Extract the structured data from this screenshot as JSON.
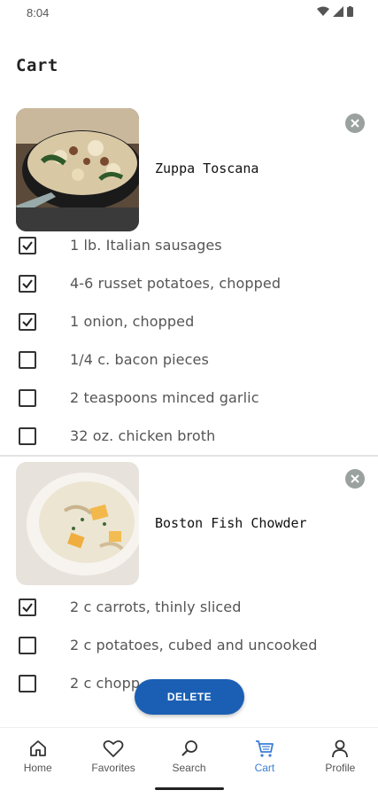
{
  "status": {
    "time": "8:04"
  },
  "page": {
    "title": "Cart"
  },
  "recipes": [
    {
      "name": "Zuppa Toscana",
      "ingredients": [
        {
          "label": "1 lb. Italian sausages",
          "checked": true
        },
        {
          "label": "4-6 russet potatoes, chopped",
          "checked": true
        },
        {
          "label": "1 onion, chopped",
          "checked": true
        },
        {
          "label": "1/4 c. bacon pieces",
          "checked": false
        },
        {
          "label": "2 teaspoons minced garlic",
          "checked": false
        },
        {
          "label": "32 oz. chicken broth",
          "checked": false
        }
      ]
    },
    {
      "name": "Boston Fish Chowder",
      "ingredients": [
        {
          "label": "2 c carrots, thinly sliced",
          "checked": true
        },
        {
          "label": "2 c potatoes, cubed and uncooked",
          "checked": false
        },
        {
          "label": "2 c chopp",
          "checked": false
        }
      ]
    }
  ],
  "actions": {
    "delete_label": "DELETE"
  },
  "nav": {
    "items": [
      {
        "label": "Home",
        "icon": "home-icon"
      },
      {
        "label": "Favorites",
        "icon": "heart-icon"
      },
      {
        "label": "Search",
        "icon": "search-icon"
      },
      {
        "label": "Cart",
        "icon": "cart-icon",
        "active": true
      },
      {
        "label": "Profile",
        "icon": "person-icon"
      }
    ]
  },
  "colors": {
    "accent": "#1a5fb4",
    "active_nav": "#3b7fd6"
  }
}
